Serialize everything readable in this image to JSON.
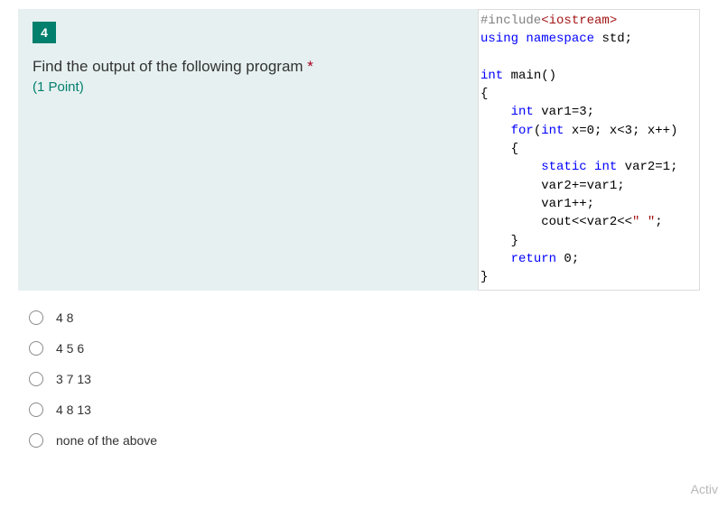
{
  "question": {
    "number": "4",
    "text": "Find the output of the following program ",
    "required_mark": "*",
    "points": "(1 Point)"
  },
  "code": {
    "l1a": "#include",
    "l1b": "<iostream>",
    "l2a": "using",
    "l2b": " ",
    "l2c": "namespace",
    "l2d": " std;",
    "l3": "",
    "l4a": "int",
    "l4b": " main()",
    "l5": "{",
    "l6a": "    ",
    "l6b": "int",
    "l6c": " var1=3;",
    "l7a": "    ",
    "l7b": "for",
    "l7c": "(",
    "l7d": "int",
    "l7e": " x=0; x<3; x++)",
    "l8": "    {",
    "l9a": "        ",
    "l9b": "static",
    "l9c": " ",
    "l9d": "int",
    "l9e": " var2=1;",
    "l10": "        var2+=var1;",
    "l11": "        var1++;",
    "l12a": "        cout<<var2<<",
    "l12b": "\" \"",
    "l12c": ";",
    "l13": "    }",
    "l14a": "    ",
    "l14b": "return",
    "l14c": " 0;",
    "l15": "}"
  },
  "options": [
    {
      "label": "4 8"
    },
    {
      "label": "4 5 6"
    },
    {
      "label": "3 7 13"
    },
    {
      "label": "4 8 13"
    },
    {
      "label": "none of the above"
    }
  ],
  "watermark": "Activ"
}
